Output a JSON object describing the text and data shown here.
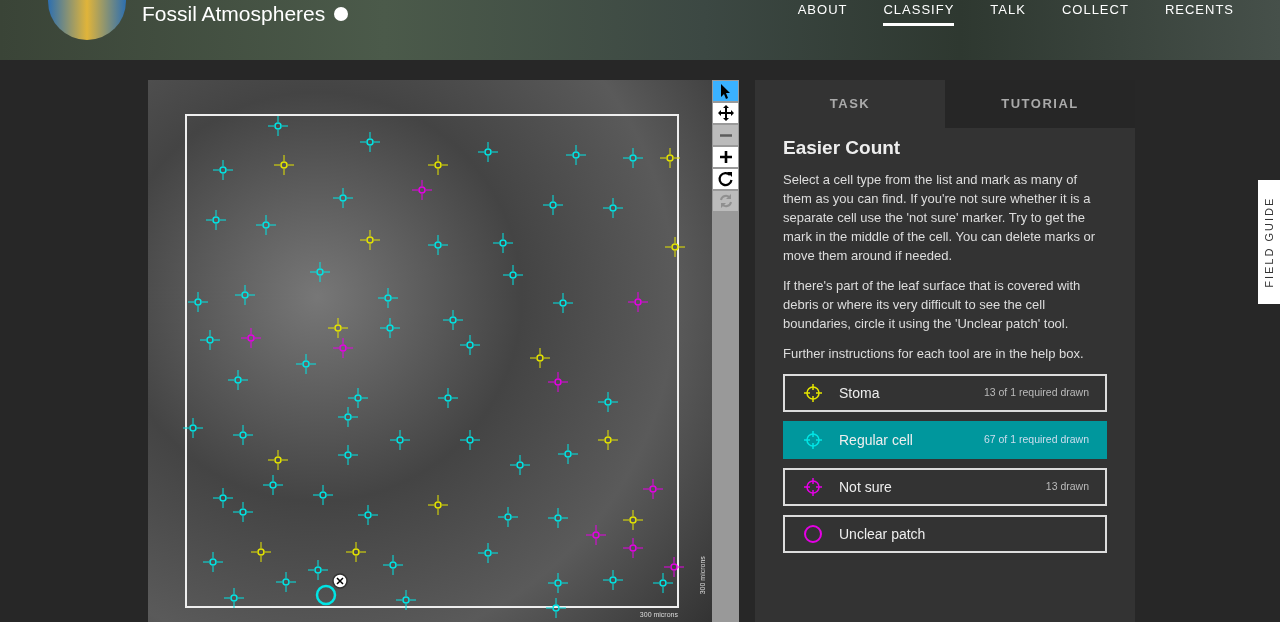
{
  "header": {
    "title": "Fossil Atmospheres",
    "nav": [
      {
        "label": "ABOUT",
        "selected": false
      },
      {
        "label": "CLASSIFY",
        "selected": true
      },
      {
        "label": "TALK",
        "selected": false
      },
      {
        "label": "COLLECT",
        "selected": false
      },
      {
        "label": "RECENTS",
        "selected": false
      }
    ]
  },
  "viewer": {
    "tools": [
      {
        "kind": "pointer",
        "selected": true,
        "disabled": false
      },
      {
        "kind": "pan",
        "selected": false,
        "disabled": false
      },
      {
        "kind": "zoom-out",
        "selected": false,
        "disabled": true
      },
      {
        "kind": "zoom-in",
        "selected": false,
        "disabled": false
      },
      {
        "kind": "rotate",
        "selected": false,
        "disabled": false
      },
      {
        "kind": "reset",
        "selected": false,
        "disabled": true
      }
    ],
    "scale_labels": [
      "300 microns",
      "300 microns"
    ]
  },
  "tabs": [
    {
      "label": "TASK",
      "selected": true
    },
    {
      "label": "TUTORIAL",
      "selected": false
    }
  ],
  "task": {
    "title": "Easier Count",
    "paragraphs": [
      "Select a cell type from the list and mark as many of them as you can find. If you're not sure whether it is a separate cell use the 'not sure' marker. Try to get the mark in the middle of the cell. You can delete marks or move them around if needed.",
      "If there's part of the leaf surface that is covered with debris or where its very difficult to see the cell boundaries, circle it using the 'Unclear patch' tool.",
      "Further instructions for each tool are in the help box."
    ],
    "tools": [
      {
        "kind": "point",
        "label": "Stoma",
        "count": "13 of 1 required drawn",
        "color": "#e5e500",
        "selected": false
      },
      {
        "kind": "point",
        "label": "Regular cell",
        "count": "67 of 1 required drawn",
        "color": "#00e5e5",
        "selected": true
      },
      {
        "kind": "point",
        "label": "Not sure",
        "count": "13 drawn",
        "color": "#e500e5",
        "selected": false
      },
      {
        "kind": "circle",
        "label": "Unclear patch",
        "color": "#e500e5",
        "selected": false
      }
    ]
  },
  "field_guide": "FIELD GUIDE"
}
